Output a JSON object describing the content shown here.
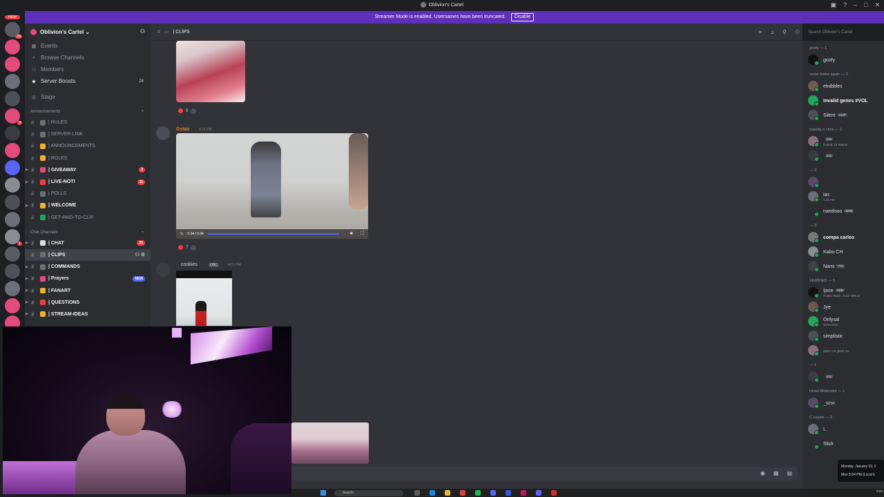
{
  "window": {
    "title": "Oblivion's Cartel"
  },
  "banner": {
    "text": "Streamer Mode is enabled. Usernames have been truncated.",
    "button": "Disable"
  },
  "guilds": {
    "new_tag": "NEW",
    "badges": [
      "16",
      "",
      "",
      "",
      "",
      "3",
      "",
      "",
      "",
      "",
      "",
      "",
      "1",
      "",
      "",
      "",
      "",
      ""
    ]
  },
  "server": {
    "name": "Oblivion's Cartel",
    "nav": [
      {
        "label": "Events",
        "icon": "calendar-icon",
        "count": ""
      },
      {
        "label": "Browse Channels",
        "icon": "browse-icon",
        "count": ""
      },
      {
        "label": "Members",
        "icon": "members-icon",
        "count": ""
      },
      {
        "label": "Server Boosts",
        "icon": "boost-icon",
        "count": "24"
      }
    ],
    "stage": "Stage",
    "categories": [
      {
        "name": "Announcements",
        "channels": [
          {
            "name": "| RULES",
            "unread": false,
            "badge": "",
            "color": "#6d6f78"
          },
          {
            "name": "| SERVER-LINK",
            "unread": false,
            "badge": "",
            "color": "#6d6f78"
          },
          {
            "name": "| ANNOUNCEMENTS",
            "unread": false,
            "badge": "",
            "color": "#f0b232"
          },
          {
            "name": "| ROLES",
            "unread": false,
            "badge": "",
            "color": "#f0b232"
          },
          {
            "name": "| GIVEAWAY",
            "unread": true,
            "badge": "2",
            "color": "#e34b7c"
          },
          {
            "name": "| LIVE-NOTI",
            "unread": true,
            "badge": "11",
            "color": "#f23f43"
          },
          {
            "name": "| POLLS",
            "unread": false,
            "badge": "",
            "color": "#6d6f78"
          },
          {
            "name": "| WELCOME",
            "unread": true,
            "badge": "",
            "color": "#f0b232"
          },
          {
            "name": "| GET-PAID-TO-CLIP",
            "unread": false,
            "badge": "",
            "color": "#23a55a"
          }
        ]
      },
      {
        "name": "Chat Channels",
        "channels": [
          {
            "name": "| CHAT",
            "unread": true,
            "badge": "21",
            "color": "#dbdee1"
          },
          {
            "name": "| CLIPS",
            "unread": true,
            "badge": "",
            "color": "#6d6f78",
            "active": true
          },
          {
            "name": "| COMMANDS",
            "unread": true,
            "badge": "",
            "color": "#6d6f78"
          },
          {
            "name": "| Prayers",
            "unread": true,
            "badge": "NEW",
            "color": "#e34b7c"
          },
          {
            "name": "| FANART",
            "unread": true,
            "badge": "",
            "color": "#f0b232"
          },
          {
            "name": "| QUESTIONS",
            "unread": true,
            "badge": "",
            "color": "#f23f43"
          },
          {
            "name": "| STREAM-IDEAS",
            "unread": true,
            "badge": "",
            "color": "#f0b232"
          }
        ]
      }
    ]
  },
  "chat": {
    "channel": "| CLIPS",
    "search_placeholder": "Search Oblivion's Cartel",
    "messages": [
      {
        "reactions": "5"
      },
      {
        "author": "Gstax",
        "author_color": "#e67e22",
        "timestamp": "4:21 PM",
        "video_time": "0:34 / 0:34",
        "reactions": "7"
      },
      {
        "author": "cookies",
        "tag": "OBC",
        "timestamp": "4:21 PM"
      }
    ]
  },
  "members": [
    {
      "group": "goofy — 1",
      "items": [
        {
          "name": "goofy",
          "bold": false,
          "tag": "",
          "sub": ""
        }
      ]
    },
    {
      "group": "never broke again — 3",
      "items": [
        {
          "name": "elnibbles",
          "bold": false,
          "tag": "",
          "sub": ""
        },
        {
          "name": "Invalid genes #VOL",
          "bold": true,
          "tag": "",
          "sub": ""
        },
        {
          "name": "Silent",
          "bold": false,
          "tag": "CLIP",
          "sub": ""
        }
      ]
    },
    {
      "group": "caseba n chris — 2",
      "items": [
        {
          "name": "",
          "bold": false,
          "tag": "x2x",
          "sub": "Rob49, Lil Wayne"
        },
        {
          "name": "",
          "bold": false,
          "tag": "x2x",
          "sub": ""
        }
      ]
    },
    {
      "group": "— 3",
      "items": [
        {
          "name": "",
          "bold": false,
          "tag": "",
          "sub": ""
        },
        {
          "name": "ias",
          "bold": false,
          "tag": "",
          "sub": "5:34 AM"
        },
        {
          "name": "nandooo",
          "bold": false,
          "tag": "SDM",
          "sub": ""
        }
      ]
    },
    {
      "group": "— 3",
      "items": [
        {
          "name": "compa carlos",
          "bold": true,
          "tag": "",
          "sub": ""
        },
        {
          "name": "Kabo CH",
          "bold": false,
          "tag": "",
          "sub": ""
        },
        {
          "name": "Nami",
          "bold": false,
          "tag": "773",
          "sub": ""
        }
      ]
    },
    {
      "group": "VERIFIED — 5",
      "items": [
        {
          "name": "Ijoce",
          "bold": false,
          "tag": "SSB",
          "sub": "Rodeo Black, Juice WRLD"
        },
        {
          "name": "Jye",
          "bold": false,
          "tag": "",
          "sub": ""
        },
        {
          "name": "Onlysal",
          "bold": false,
          "tag": "",
          "sub": "Demo time"
        },
        {
          "name": "simplistic",
          "bold": false,
          "tag": "",
          "sub": ""
        },
        {
          "name": "",
          "bold": false,
          "tag": "",
          "sub": "glaze me glaze me"
        }
      ]
    },
    {
      "group": "— 1",
      "items": [
        {
          "name": "",
          "bold": false,
          "tag": "x2x",
          "sub": ""
        }
      ]
    },
    {
      "group": "Head Moderator — 1",
      "items": [
        {
          "name": "_scvr.",
          "bold": false,
          "tag": "",
          "sub": ""
        }
      ]
    },
    {
      "group": "C Loyals — 2",
      "items": [
        {
          "name": "L.",
          "bold": false,
          "tag": "",
          "sub": ""
        },
        {
          "name": "Slick",
          "bold": false,
          "tag": "",
          "sub": ""
        }
      ]
    }
  ],
  "tooltip": {
    "line1": "Monday, January 19, 2",
    "line2": "Mon 5:04 PM (Local ti"
  },
  "taskbar": {
    "search": "Search",
    "clock": "5:04"
  }
}
